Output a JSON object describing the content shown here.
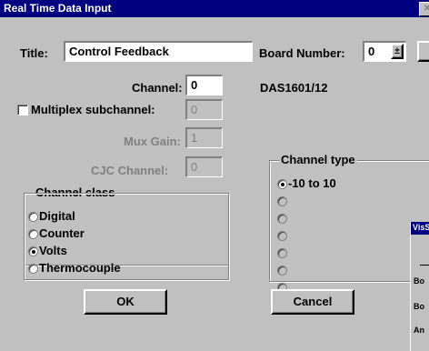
{
  "window": {
    "title": "Real Time Data Input"
  },
  "title_field": {
    "label": "Title:",
    "value": "Control Feedback"
  },
  "board": {
    "label": "Board Number:",
    "value": "0",
    "spin": "±",
    "model": "DAS1601/12"
  },
  "channel": {
    "label": "Channel:",
    "value": "0"
  },
  "multiplex": {
    "label": "Multiplex subchannel:",
    "value": "0",
    "checked": false
  },
  "mux_gain": {
    "label": "Mux Gain:",
    "value": "1"
  },
  "cjc_channel": {
    "label": "CJC Channel:",
    "value": "0"
  },
  "channel_class": {
    "legend": "Channel class",
    "options": [
      "Digital",
      "Counter",
      "Volts",
      "Thermocouple"
    ],
    "selected": "Volts"
  },
  "channel_type": {
    "legend": "Channel type",
    "options": [
      "-10 to 10",
      "",
      "",
      "",
      "",
      "",
      ""
    ],
    "selected_index": 0
  },
  "buttons": {
    "ok": "OK",
    "cancel": "Cancel"
  },
  "background_window": {
    "title": "VisS",
    "lines": [
      "Bo",
      "Bo",
      "An"
    ]
  }
}
